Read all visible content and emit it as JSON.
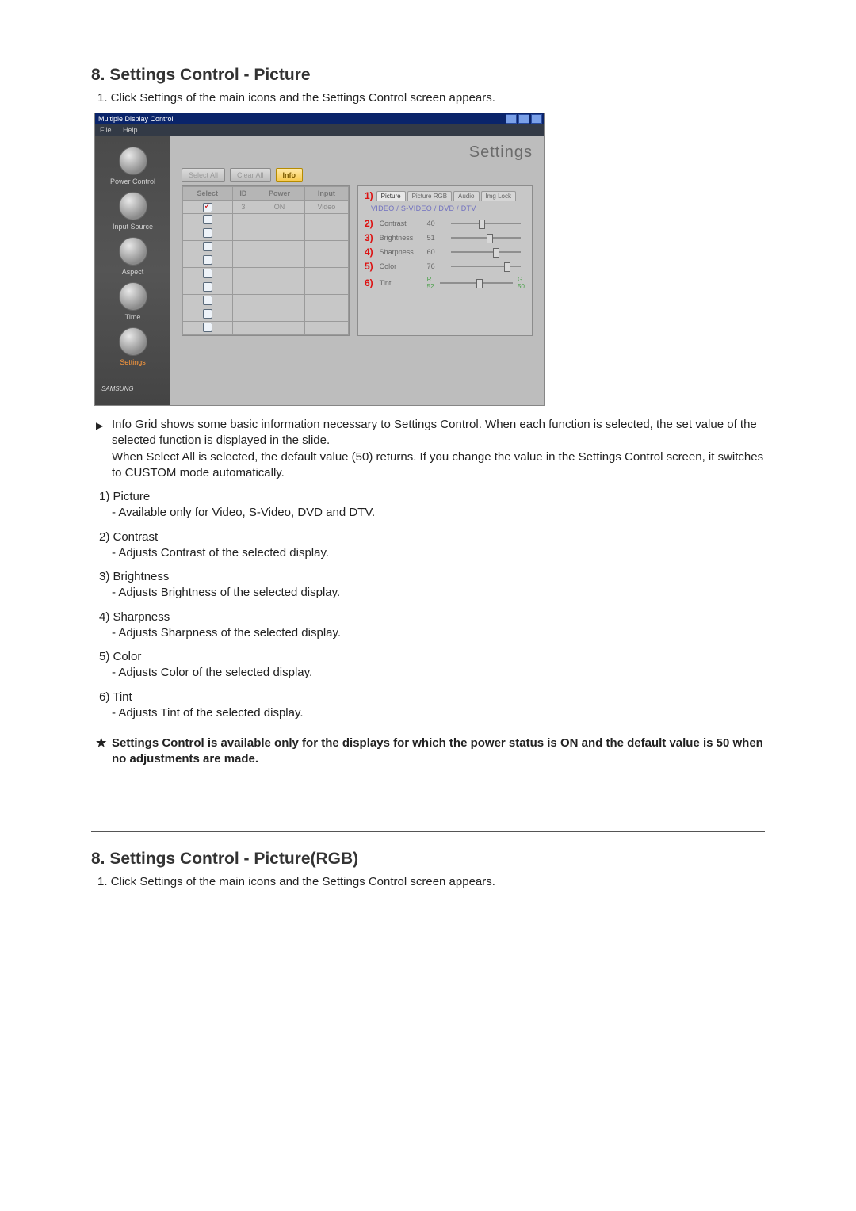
{
  "section1": {
    "heading": "8. Settings Control - Picture",
    "step1": "1.  Click Settings of the main icons and the Settings Control screen appears."
  },
  "shot": {
    "title": "Multiple Display Control",
    "menu": {
      "file": "File",
      "help": "Help"
    },
    "sidebar": {
      "power": "Power Control",
      "input": "Input Source",
      "aspect": "Aspect",
      "time": "Time",
      "settings": "Settings"
    },
    "brand": "SAMSUNG",
    "panelTitle": "Settings",
    "toolbar": {
      "selectAll": "Select All",
      "clearAll": "Clear All",
      "info": "Info"
    },
    "grid": {
      "h1": "Select",
      "h2": "ID",
      "h3": "Power",
      "h4": "Input",
      "r1_id": "3",
      "r1_power": "ON",
      "r1_input": "Video"
    },
    "tabs": {
      "picture": "Picture",
      "pictureRGB": "Picture RGB",
      "audio": "Audio",
      "imgLock": "Img Lock"
    },
    "source": "VIDEO / S-VIDEO / DVD / DTV",
    "sliders": {
      "contrast": {
        "label": "Contrast",
        "value": "40"
      },
      "brightness": {
        "label": "Brightness",
        "value": "51"
      },
      "sharpness": {
        "label": "Sharpness",
        "value": "60"
      },
      "color": {
        "label": "Color",
        "value": "76"
      },
      "tint": {
        "label": "Tint",
        "capL": "R\n52",
        "capR": "G\n50"
      }
    },
    "red": {
      "n1": "1)",
      "n2": "2)",
      "n3": "3)",
      "n4": "4)",
      "n5": "5)",
      "n6": "6)"
    }
  },
  "info": {
    "main": "Info Grid shows some basic information necessary to Settings Control. When each function is selected, the set value of the selected function is displayed in the slide.",
    "line2": "When Select All is selected, the default value (50) returns. If you change the value in the Settings Control screen, it switches to CUSTOM mode automatically."
  },
  "items": {
    "i1h": "1) Picture",
    "i1s": "- Available only for Video, S-Video, DVD and DTV.",
    "i2h": "2) Contrast",
    "i2s": "- Adjusts Contrast of the selected display.",
    "i3h": "3) Brightness",
    "i3s": "- Adjusts Brightness of the selected display.",
    "i4h": "4) Sharpness",
    "i4s": "- Adjusts Sharpness of the selected display.",
    "i5h": "5) Color",
    "i5s": "- Adjusts Color of the selected display.",
    "i6h": "6) Tint",
    "i6s": "- Adjusts Tint of the selected display."
  },
  "note": "Settings Control is available only for the displays for which the power status is ON and the default value is 50 when no adjustments are made.",
  "section2": {
    "heading": "8. Settings Control - PictureRGB)",
    "heading_fixed": "8. Settings Control - Picture(RGB)",
    "step1": "1.  Click Settings of the main icons and the Settings Control screen appears."
  }
}
